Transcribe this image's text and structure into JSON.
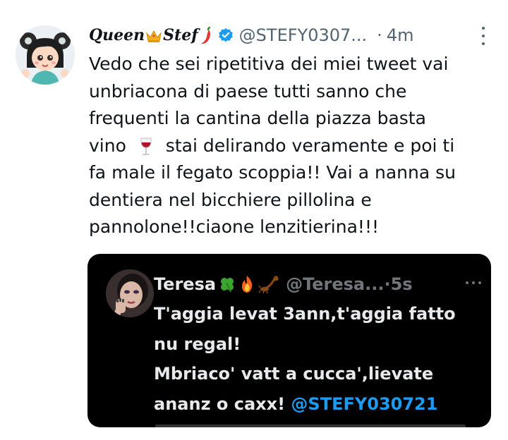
{
  "tweet": {
    "author": {
      "name_part1": "Queen",
      "name_part2": "Stef",
      "handle": "@STEFY0307...",
      "avatar": "cartoon-girl-avatar"
    },
    "separator": "·",
    "time": "4m",
    "text_lines": [
      "Vedo che sei ripetitiva dei miei tweet vai",
      "unbriacona di paese tutti sanno che",
      "frequenti la cantina della piazza basta",
      "vino",
      "stai delirando veramente e poi ti",
      "fa male il fegato scoppia!! Vai a nanna su",
      "dentiera nel bicchiere pillolina e",
      "pannolone!!ciaone lenzitierina!!!"
    ],
    "colors": {
      "verified_badge": "#1d9bf0",
      "secondary_text": "#536471"
    }
  },
  "quoted_tweet": {
    "author": {
      "name": "Teresa",
      "handle": "@Teresa...",
      "avatar": "woman-portrait-avatar"
    },
    "separator": "·",
    "time": "5s",
    "text_lines": [
      "T'aggia levat  3ann,t'aggia fatto",
      "nu regal!",
      "Mbriaco' vatt a cucca',lievate",
      "ananz o caxx!"
    ],
    "mention": "@STEFY030721",
    "colors": {
      "background": "#000000",
      "mention": "#1d9bf0"
    }
  },
  "icons": [
    "crown-emoji",
    "chili-pepper-emoji",
    "verified-badge-icon",
    "more-options-icon",
    "wine-glass-emoji",
    "four-leaf-clover-emoji",
    "fire-emoji",
    "scorpion-emoji"
  ]
}
